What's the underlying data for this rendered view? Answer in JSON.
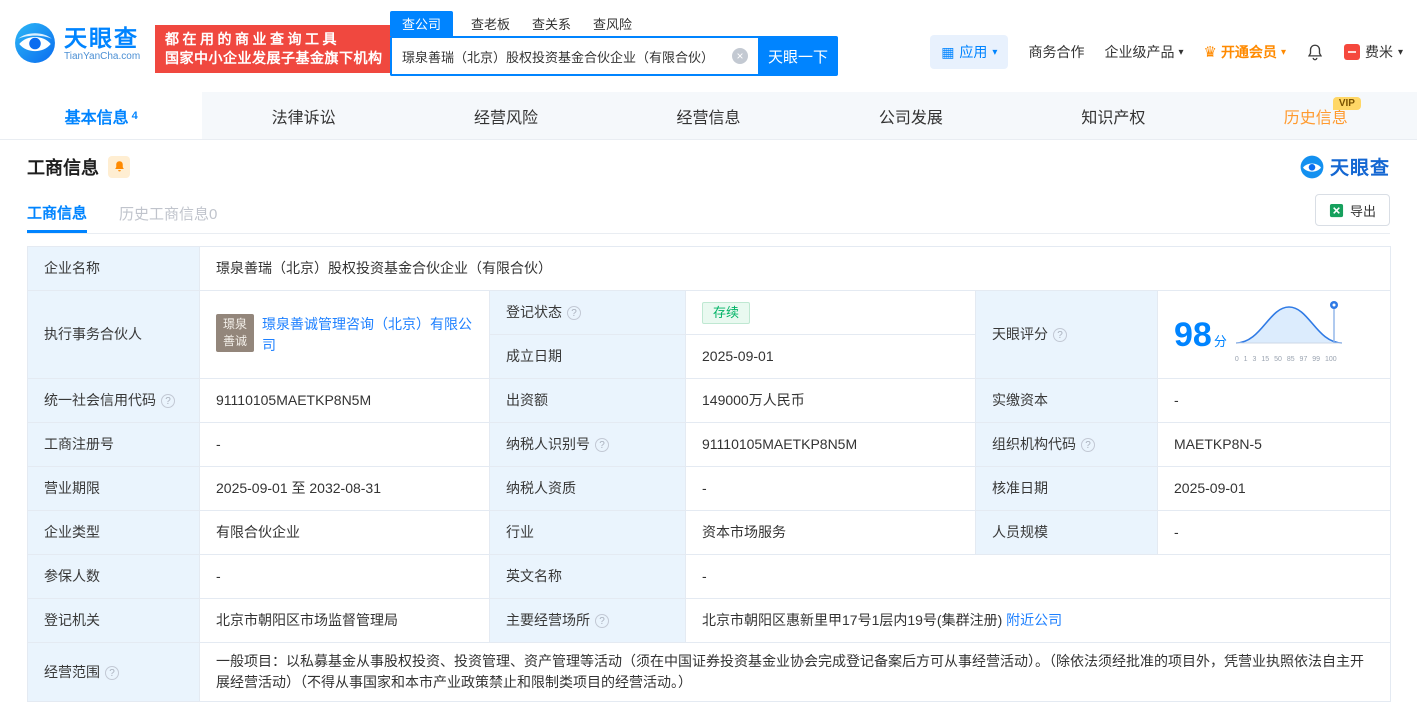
{
  "brand": {
    "name": "天眼查",
    "domain": "TianYanCha.com",
    "slogan1": "都在用的商业查询工具",
    "slogan2": "国家中小企业发展子基金旗下机构"
  },
  "icons": {
    "help": "?",
    "caret": "▾",
    "clear": "×",
    "apps": "▦",
    "crown": "♛"
  },
  "header": {
    "search_tabs": [
      {
        "label": "查公司"
      },
      {
        "label": "查老板"
      },
      {
        "label": "查关系"
      },
      {
        "label": "查风险"
      }
    ],
    "search": {
      "value": "璟泉善瑞（北京）股权投资基金合伙企业（有限合伙）",
      "button": "天眼一下"
    },
    "apps": "应用",
    "biz_coop": "商务合作",
    "enterprise_products": "企业级产品",
    "vip_join": "开通会员",
    "username": "费米"
  },
  "nav": {
    "tabs": [
      {
        "label": "基本信息",
        "count": "4"
      },
      {
        "label": "法律诉讼"
      },
      {
        "label": "经营风险"
      },
      {
        "label": "经营信息"
      },
      {
        "label": "公司发展"
      },
      {
        "label": "知识产权"
      },
      {
        "label": "历史信息",
        "badge": "VIP"
      }
    ]
  },
  "section": {
    "title": "工商信息"
  },
  "subtabs": {
    "current": "工商信息",
    "history": "历史工商信息0",
    "export": "导出"
  },
  "table": {
    "company_name": {
      "label": "企业名称",
      "value": "璟泉善瑞（北京）股权投资基金合伙企业（有限合伙）"
    },
    "partner": {
      "label": "执行事务合伙人",
      "logo_line1": "璟泉",
      "logo_line2": "善诚",
      "value": "璟泉善诚管理咨询（北京）有限公司"
    },
    "reg_status": {
      "label": "登记状态",
      "value": "存续"
    },
    "establish_date": {
      "label": "成立日期",
      "value": "2025-09-01"
    },
    "score": {
      "label": "天眼评分",
      "value": "98",
      "unit": "分",
      "axis": "0 1 3 15 50 85 97 99 100"
    },
    "credit_code": {
      "label": "统一社会信用代码",
      "value": "91110105MAETKP8N5M"
    },
    "capital": {
      "label": "出资额",
      "value": "149000万人民币"
    },
    "paid_capital": {
      "label": "实缴资本",
      "value": "-"
    },
    "reg_no": {
      "label": "工商注册号",
      "value": "-"
    },
    "taxpayer_id": {
      "label": "纳税人识别号",
      "value": "91110105MAETKP8N5M"
    },
    "org_code": {
      "label": "组织机构代码",
      "value": "MAETKP8N-5"
    },
    "term": {
      "label": "营业期限",
      "value": "2025-09-01 至 2032-08-31"
    },
    "taxpayer_quality": {
      "label": "纳税人资质",
      "value": "-"
    },
    "approval_date": {
      "label": "核准日期",
      "value": "2025-09-01"
    },
    "type": {
      "label": "企业类型",
      "value": "有限合伙企业"
    },
    "industry": {
      "label": "行业",
      "value": "资本市场服务"
    },
    "staff": {
      "label": "人员规模",
      "value": "-"
    },
    "insured": {
      "label": "参保人数",
      "value": "-"
    },
    "english_name": {
      "label": "英文名称",
      "value": "-"
    },
    "authority": {
      "label": "登记机关",
      "value": "北京市朝阳区市场监督管理局"
    },
    "address": {
      "label": "主要经营场所",
      "value": "北京市朝阳区惠新里甲17号1层内19号(集群注册)",
      "link": "附近公司"
    },
    "scope": {
      "label": "经营范围",
      "value": "一般项目：以私募基金从事股权投资、投资管理、资产管理等活动（须在中国证券投资基金业协会完成登记备案后方可从事经营活动）。（除依法须经批准的项目外，凭营业执照依法自主开展经营活动）（不得从事国家和本市产业政策禁止和限制类项目的经营活动。）"
    }
  }
}
